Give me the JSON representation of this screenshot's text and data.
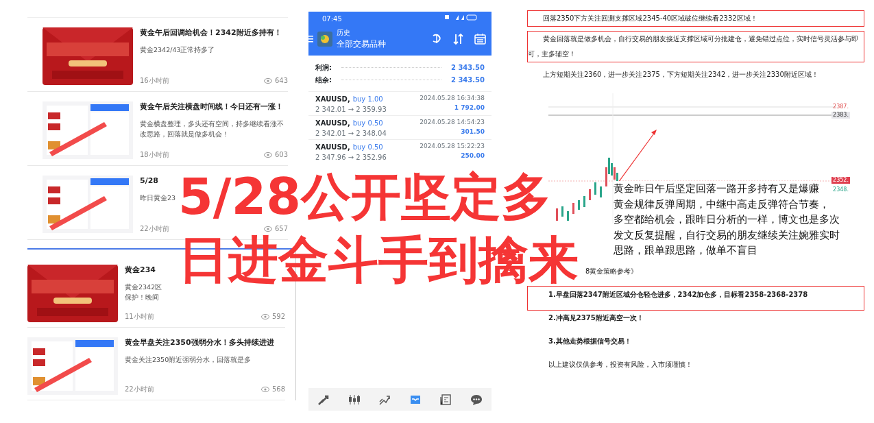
{
  "overlay_title": [
    "5/28公开坚定多",
    "日进金斗手到擒来"
  ],
  "article_lists": [
    [
      {
        "kind": "banner",
        "title": "黄金午后回调给机会！2342附近多持有！",
        "summary_lines": [
          "黄金2342/43正常持多了"
        ],
        "time": "16小时前",
        "views": "643"
      },
      {
        "kind": "screenshot",
        "title": "黄金午后关注横盘时间线！今日还有一涨！",
        "summary_lines": [
          "黄金横盘整理，多头还有空间，持多继续看涨不改思路，回落就是做多机会！"
        ],
        "time": "18小时前",
        "views": "603"
      },
      {
        "kind": "screenshot",
        "title": "5/28",
        "summary_lines": [
          "昨日黄金23"
        ],
        "time": "22小时前",
        "views": "657"
      }
    ],
    [
      {
        "kind": "banner",
        "title": "黄金234",
        "summary_lines": [
          "黄金2342区",
          "保护！晚间"
        ],
        "time": "11小时前",
        "views": "592"
      },
      {
        "kind": "screenshot",
        "title": "黄金早盘关注2350强弱分水！多头持续进进",
        "summary_lines": [
          "黄金关注2350附近强弱分水，回落就是多"
        ],
        "time": "22小时前",
        "views": "568"
      }
    ]
  ],
  "trading_app": {
    "status_time": "07:45",
    "header_subtitle": "历史",
    "header_title": "全部交易品种",
    "summary": [
      {
        "label": "利润:",
        "value": "2 343.50"
      },
      {
        "label": "结余:",
        "value": "2 343.50"
      }
    ],
    "trades": [
      {
        "symbol": "XAUUSD,",
        "side": "buy 1.00",
        "prices": "2 342.01 → 2 359.93",
        "time": "2024.05.28 16:34:38",
        "profit": "1 792.00"
      },
      {
        "symbol": "XAUUSD,",
        "side": "buy 0.50",
        "prices": "2 342.01 → 2 348.04",
        "time": "2024.05.28 14:54:23",
        "profit": "301.50"
      },
      {
        "symbol": "XAUUSD,",
        "side": "buy 0.50",
        "prices": "2 347.96 → 2 352.96",
        "time": "2024.05.28 15:22:23",
        "profit": "250.00"
      }
    ],
    "bottom_nav": [
      {
        "kind": "trade",
        "selected": false
      },
      {
        "kind": "quotes",
        "selected": false
      },
      {
        "kind": "chart",
        "selected": false
      },
      {
        "kind": "inbox",
        "selected": true
      },
      {
        "kind": "news",
        "selected": false
      },
      {
        "kind": "chat",
        "selected": false
      }
    ]
  },
  "analysis": {
    "paragraphs": [
      {
        "text": "回落2350下方关注回测支撑区域2345-40区域破位继续看2332区域！",
        "highlighted": true
      },
      {
        "text": "黄金回落就是做多机会，自行交易的朋友接近支撑区域可分批建仓，避免错过点位，实时信号灵活参与即可，主多辅空！",
        "highlighted": true
      },
      {
        "text": "上方短期关注2360，进一步关注2375，下方短期关注2342，进一步关注2330附近区域！",
        "highlighted": false
      }
    ],
    "price_labels": [
      {
        "text": "2387.",
        "kind": "down"
      },
      {
        "text": "2383.",
        "kind": "line"
      },
      {
        "text": "2352.",
        "kind": "current"
      },
      {
        "text": "2348.",
        "kind": "up"
      }
    ],
    "comment_lines": [
      "黄金昨日午后坚定回落一路开多持有又是爆赚",
      "黄金规律反弹周期，中继中高走反弹符合节奏，",
      "多空都给机会，跟昨日分析的一样，博文也是多次",
      "发文反复提醒，自行交易的朋友继续关注婉雅实时",
      "思路，跟单跟思路，做单不盲目"
    ],
    "strategy_title": "8黄金策略参考》",
    "strategy": [
      {
        "text": "1.早盘回落2347附近区域分仓轻仓进多，2342加仓多，目标看2358-2368-2378",
        "highlighted": true
      },
      {
        "text": "2.冲高见2375附近高空一次！",
        "highlighted": false
      },
      {
        "text": "3.其他走势根据信号交易！",
        "highlighted": false
      }
    ],
    "disclaimer": "以上建议仅供参考，投资有风险，入市须谨慎！"
  }
}
